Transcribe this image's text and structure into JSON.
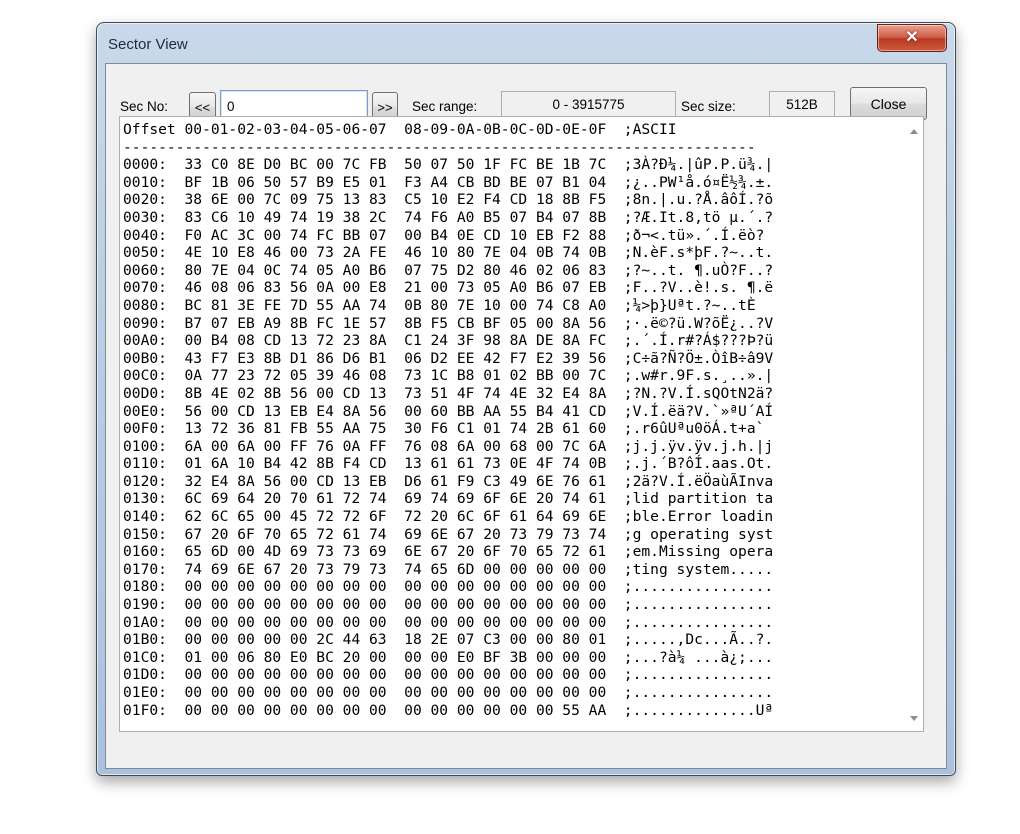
{
  "window": {
    "title": "Sector View",
    "close_glyph": "✕"
  },
  "toolbar": {
    "sec_no_label": "Sec No:",
    "prev_label": "<<",
    "sec_no_value": "0",
    "next_label": ">>",
    "range_label": "Sec range:",
    "range_value": "0 - 3915775",
    "size_label": "Sec size:",
    "size_value": "512B",
    "close_label": "Close"
  },
  "dump": {
    "header": "Offset 00-01-02-03-04-05-06-07  08-09-0A-0B-0C-0D-0E-0F  ;ASCII",
    "separator": "------------------------------------------------------------------------",
    "rows": [
      "0000:  33 C0 8E D0 BC 00 7C FB  50 07 50 1F FC BE 1B 7C  ;3À?Ð¼.|ûP.P.ü¾.|",
      "0010:  BF 1B 06 50 57 B9 E5 01  F3 A4 CB BD BE 07 B1 04  ;¿..PW¹å.ó¤Ë½¾.±.",
      "0020:  38 6E 00 7C 09 75 13 83  C5 10 E2 F4 CD 18 8B F5  ;8n.|.u.?Å.âôÍ.?õ",
      "0030:  83 C6 10 49 74 19 38 2C  74 F6 A0 B5 07 B4 07 8B  ;?Æ.It.8,tö µ.´.?",
      "0040:  F0 AC 3C 00 74 FC BB 07  00 B4 0E CD 10 EB F2 88  ;ð¬<.tü».´.Í.ëò?",
      "0050:  4E 10 E8 46 00 73 2A FE  46 10 80 7E 04 0B 74 0B  ;N.èF.s*þF.?~..t.",
      "0060:  80 7E 04 0C 74 05 A0 B6  07 75 D2 80 46 02 06 83  ;?~..t. ¶.uÒ?F..?",
      "0070:  46 08 06 83 56 0A 00 E8  21 00 73 05 A0 B6 07 EB  ;F..?V..è!.s. ¶.ë",
      "0080:  BC 81 3E FE 7D 55 AA 74  0B 80 7E 10 00 74 C8 A0  ;¼>þ}Uªt.?~..tÈ ",
      "0090:  B7 07 EB A9 8B FC 1E 57  8B F5 CB BF 05 00 8A 56  ;·.ë©?ü.W?õË¿..?V",
      "00A0:  00 B4 08 CD 13 72 23 8A  C1 24 3F 98 8A DE 8A FC  ;.´.Í.r#?Á$???Þ?ü",
      "00B0:  43 F7 E3 8B D1 86 D6 B1  06 D2 EE 42 F7 E2 39 56  ;C÷ã?Ñ?Ö±.ÒîB÷â9V",
      "00C0:  0A 77 23 72 05 39 46 08  73 1C B8 01 02 BB 00 7C  ;.w#r.9F.s.¸..».|",
      "00D0:  8B 4E 02 8B 56 00 CD 13  73 51 4F 74 4E 32 E4 8A  ;?N.?V.Í.sQOtN2ä?",
      "00E0:  56 00 CD 13 EB E4 8A 56  00 60 BB AA 55 B4 41 CD  ;V.Í.ëä?V.`»ªU´AÍ",
      "00F0:  13 72 36 81 FB 55 AA 75  30 F6 C1 01 74 2B 61 60  ;.r6ûUªu0öÁ.t+a`",
      "0100:  6A 00 6A 00 FF 76 0A FF  76 08 6A 00 68 00 7C 6A  ;j.j.ÿv.ÿv.j.h.|j",
      "0110:  01 6A 10 B4 42 8B F4 CD  13 61 61 73 0E 4F 74 0B  ;.j.´B?ôÍ.aas.Ot.",
      "0120:  32 E4 8A 56 00 CD 13 EB  D6 61 F9 C3 49 6E 76 61  ;2ä?V.Í.ëÖaùÃInva",
      "0130:  6C 69 64 20 70 61 72 74  69 74 69 6F 6E 20 74 61  ;lid partition ta",
      "0140:  62 6C 65 00 45 72 72 6F  72 20 6C 6F 61 64 69 6E  ;ble.Error loadin",
      "0150:  67 20 6F 70 65 72 61 74  69 6E 67 20 73 79 73 74  ;g operating syst",
      "0160:  65 6D 00 4D 69 73 73 69  6E 67 20 6F 70 65 72 61  ;em.Missing opera",
      "0170:  74 69 6E 67 20 73 79 73  74 65 6D 00 00 00 00 00  ;ting system.....",
      "0180:  00 00 00 00 00 00 00 00  00 00 00 00 00 00 00 00  ;................",
      "0190:  00 00 00 00 00 00 00 00  00 00 00 00 00 00 00 00  ;................",
      "01A0:  00 00 00 00 00 00 00 00  00 00 00 00 00 00 00 00  ;................",
      "01B0:  00 00 00 00 00 2C 44 63  18 2E 07 C3 00 00 80 01  ;.....,Dc...Ã..?.",
      "01C0:  01 00 06 80 E0 BC 20 00  00 00 E0 BF 3B 00 00 00  ;...?à¼ ...à¿;...",
      "01D0:  00 00 00 00 00 00 00 00  00 00 00 00 00 00 00 00  ;................",
      "01E0:  00 00 00 00 00 00 00 00  00 00 00 00 00 00 00 00  ;................",
      "01F0:  00 00 00 00 00 00 00 00  00 00 00 00 00 00 55 AA  ;..............Uª"
    ]
  }
}
